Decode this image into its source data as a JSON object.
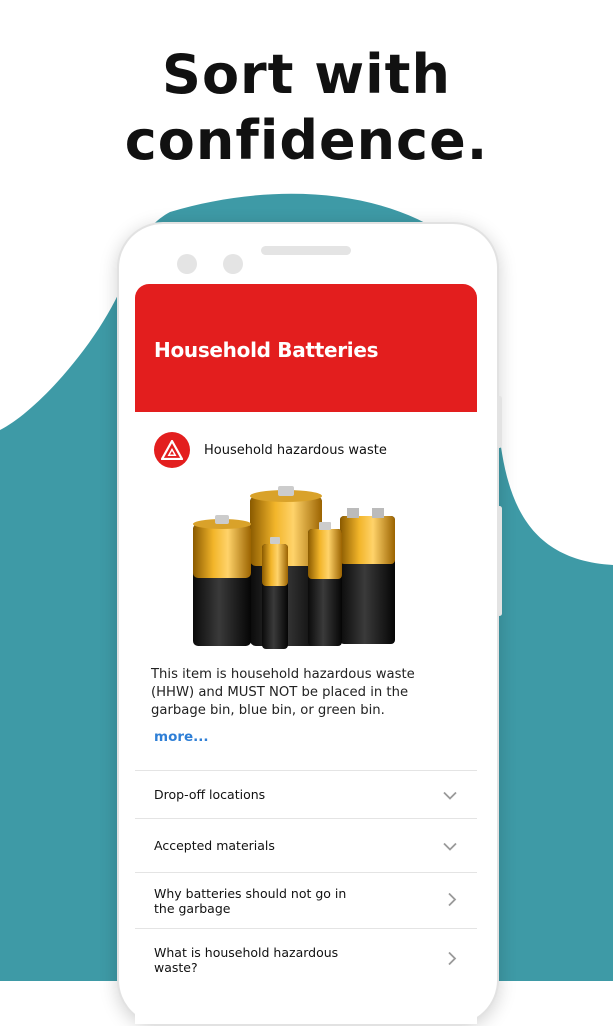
{
  "headline": {
    "line1": "Sort with",
    "line2": "confidence."
  },
  "colors": {
    "brand_red": "#e31e1e",
    "teal_blob": "#3e9aa6",
    "link_blue": "#2f7fd6"
  },
  "screen": {
    "title": "Household Batteries",
    "category": {
      "icon": "hazard-triangle-icon",
      "label": "Household hazardous waste"
    },
    "image": "batteries-image",
    "description": "This item is household hazardous waste (HHW) and MUST NOT be placed in the garbage bin, blue bin, or green bin.",
    "more_label": "more...",
    "sections": [
      {
        "label": "Drop-off locations",
        "icon": "chevron-down-icon"
      },
      {
        "label": "Accepted materials",
        "icon": "chevron-down-icon"
      },
      {
        "label": "Why batteries should not go in the garbage",
        "icon": "chevron-right-icon"
      },
      {
        "label": "What is household hazardous waste?",
        "icon": "chevron-right-icon"
      }
    ]
  }
}
